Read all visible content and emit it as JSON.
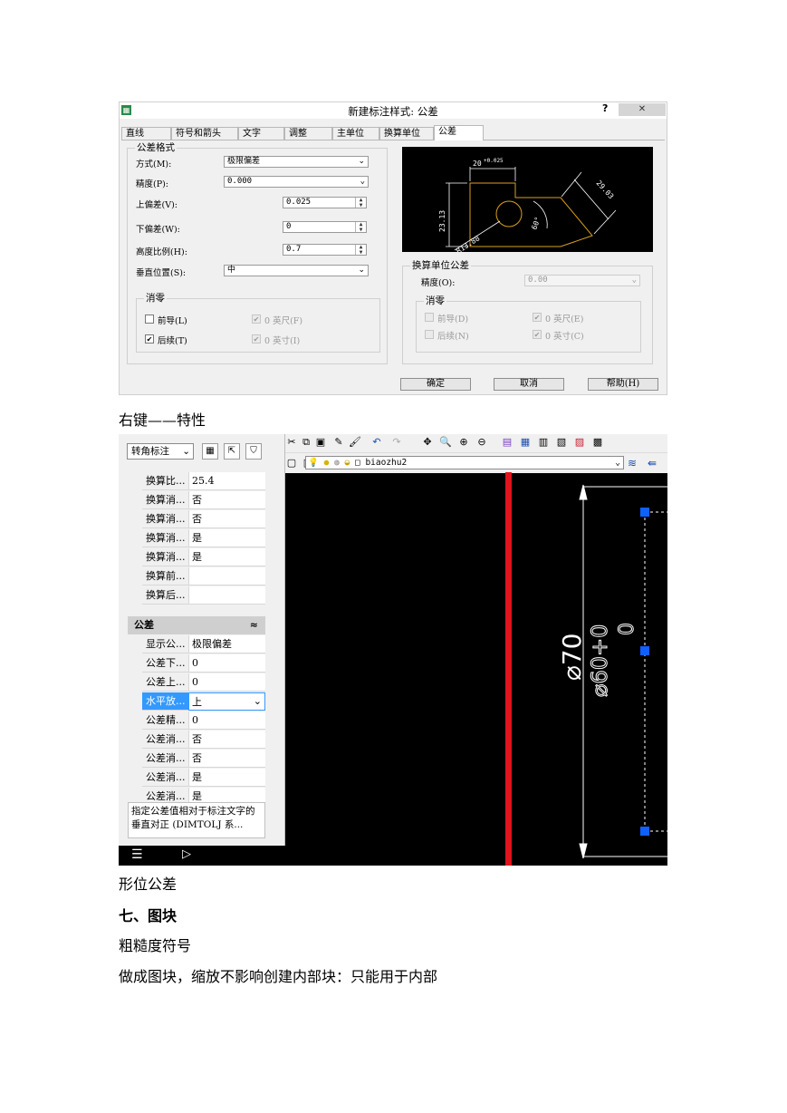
{
  "dialog": {
    "title": "新建标注样式: 公差",
    "help_glyph": "?",
    "close_glyph": "✕",
    "tabs": [
      "直线",
      "符号和箭头",
      "文字",
      "调整",
      "主单位",
      "换算单位",
      "公差"
    ],
    "active_tab": "公差",
    "tolerance_format": {
      "group_title": "公差格式",
      "method_label": "方式(M):",
      "method_value": "极限偏差",
      "precision_label": "精度(P):",
      "precision_value": "0.000",
      "upper_label": "上偏差(V):",
      "upper_value": "0.025",
      "lower_label": "下偏差(W):",
      "lower_value": "0",
      "height_label": "高度比例(H):",
      "height_value": "0.7",
      "vpos_label": "垂直位置(S):",
      "vpos_value": "中"
    },
    "zero_suppress": {
      "group_title": "消零",
      "leading": {
        "label": "前导(L)",
        "checked": false
      },
      "trailing": {
        "label": "后续(T)",
        "checked": true
      },
      "feet": {
        "label": "0 英尺(F)",
        "checked": true
      },
      "inches": {
        "label": "0 英寸(I)",
        "checked": true
      }
    },
    "alt_unit_tolerance": {
      "group_title": "换算单位公差",
      "precision_label": "精度(O):",
      "precision_value": "0.00",
      "zero_group_title": "消零",
      "leading": {
        "label": "前导(D)",
        "checked": false
      },
      "trailing": {
        "label": "后续(N)",
        "checked": false
      },
      "feet": {
        "label": "0 英尺(E)",
        "checked": true
      },
      "inches": {
        "label": "0 英寸(C)",
        "checked": true
      }
    },
    "preview": {
      "dim_top": "20",
      "dim_top_tol": "+0.025",
      "dim_left": "23.13",
      "dim_right": "29.03",
      "dim_radius": "R13.88",
      "dim_angle": "60°"
    },
    "buttons": {
      "ok": "确定",
      "cancel": "取消",
      "help": "帮助(H)"
    }
  },
  "text": {
    "caption1": "右键——特性",
    "caption2": "形位公差",
    "heading": "七、图块",
    "line3": "粗糙度符号",
    "line4": "做成图块，缩放不影响创建内部块：只能用于内部"
  },
  "cad": {
    "object_type": "转角标注",
    "layer_name": "biaozhu2",
    "properties_top": [
      {
        "k": "换算比...",
        "v": "25.4"
      },
      {
        "k": "换算消...",
        "v": "否"
      },
      {
        "k": "换算消...",
        "v": "否"
      },
      {
        "k": "换算消...",
        "v": "是"
      },
      {
        "k": "换算消...",
        "v": "是"
      },
      {
        "k": "换算前...",
        "v": ""
      },
      {
        "k": "换算后...",
        "v": ""
      }
    ],
    "section_title": "公差",
    "section_toggle": "≈",
    "properties_tol": [
      {
        "k": "显示公...",
        "v": "极限偏差"
      },
      {
        "k": "公差下...",
        "v": "0"
      },
      {
        "k": "公差上...",
        "v": "0"
      },
      {
        "k": "水平放...",
        "v": "上"
      },
      {
        "k": "公差精...",
        "v": "0"
      },
      {
        "k": "公差消...",
        "v": "否"
      },
      {
        "k": "公差消...",
        "v": "否"
      },
      {
        "k": "公差消...",
        "v": "是"
      },
      {
        "k": "公差消...",
        "v": "是"
      }
    ],
    "description": "指定公差值相对于标注文字的垂直对正 (DIMTOLJ 系...",
    "dim_text_main": "⌀70",
    "dim_text_2": "⌀60+0",
    "dim_text_3": "0"
  },
  "colors": {
    "red_line": "#e0141c",
    "grip": "#1060ff",
    "highlight": "#3399ff"
  }
}
